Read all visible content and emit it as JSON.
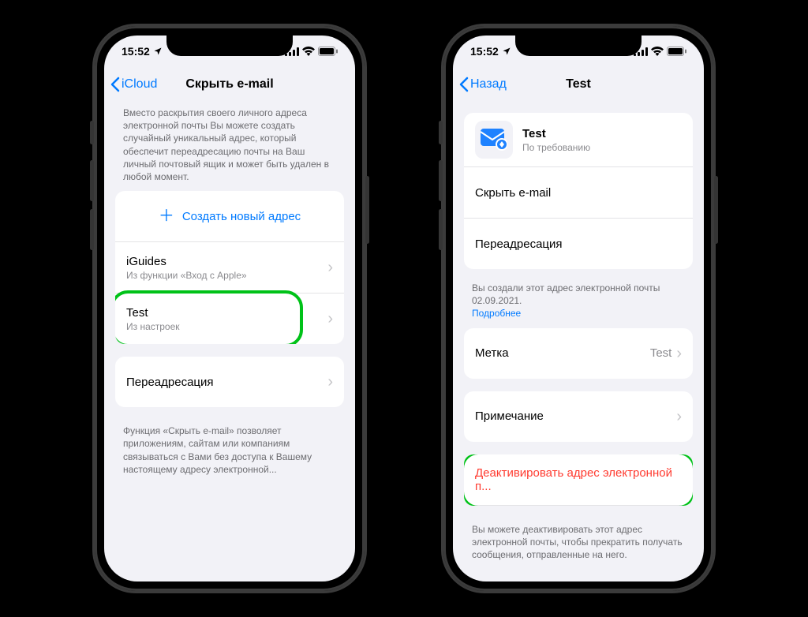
{
  "status": {
    "time": "15:52"
  },
  "left": {
    "back": "iCloud",
    "title": "Скрыть e-mail",
    "intro": "Вместо раскрытия своего личного адреса электронной почты Вы можете создать случайный уникальный адрес, который обеспечит переадресацию почты на Ваш личный почтовый ящик и может быть удален в любой момент.",
    "create": "Создать новый адрес",
    "items": [
      {
        "title": "iGuides",
        "sub": "Из функции «Вход с Apple»"
      },
      {
        "title": "Test",
        "sub": "Из настроек"
      }
    ],
    "forward": "Переадресация",
    "footer": "Функция «Скрыть e-mail» позволяет приложениям, сайтам или компаниям связываться с Вами без доступа к Вашему настоящему адресу электронной..."
  },
  "right": {
    "back": "Назад",
    "title": "Test",
    "card_title": "Test",
    "card_sub": "По требованию",
    "hide": "Скрыть e-mail",
    "forward": "Переадресация",
    "created": "Вы создали этот адрес электронной почты 02.09.2021.",
    "more": "Подробнее",
    "label": "Метка",
    "label_value": "Test",
    "note": "Примечание",
    "deactivate": "Деактивировать адрес электронной п...",
    "deactivate_footer": "Вы можете деактивировать этот адрес электронной почты, чтобы прекратить получать сообщения, отправленные на него."
  }
}
